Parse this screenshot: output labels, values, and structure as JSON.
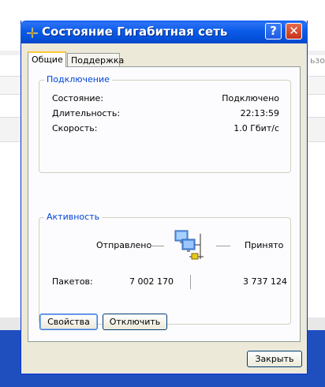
{
  "background": {
    "fragment_text": "ьзо"
  },
  "window": {
    "title": "Состояние Гигабитная сеть",
    "help_button": "?",
    "close_button": "✕"
  },
  "tabs": [
    {
      "label": "Общие"
    },
    {
      "label": "Поддержка"
    }
  ],
  "connection": {
    "group_title": "Подключение",
    "rows": [
      {
        "label": "Состояние:",
        "value": "Подключено"
      },
      {
        "label": "Длительность:",
        "value": "22:13:59"
      },
      {
        "label": "Скорость:",
        "value": "1.0 Гбит/с"
      }
    ]
  },
  "activity": {
    "group_title": "Активность",
    "sent_label": "Отправлено",
    "received_label": "Принято",
    "packets_label": "Пакетов:",
    "packets_sent": "7 002 170",
    "packets_received": "3 737 124"
  },
  "buttons": {
    "properties": "Свойства",
    "disconnect": "Отключить",
    "close": "Закрыть"
  }
}
